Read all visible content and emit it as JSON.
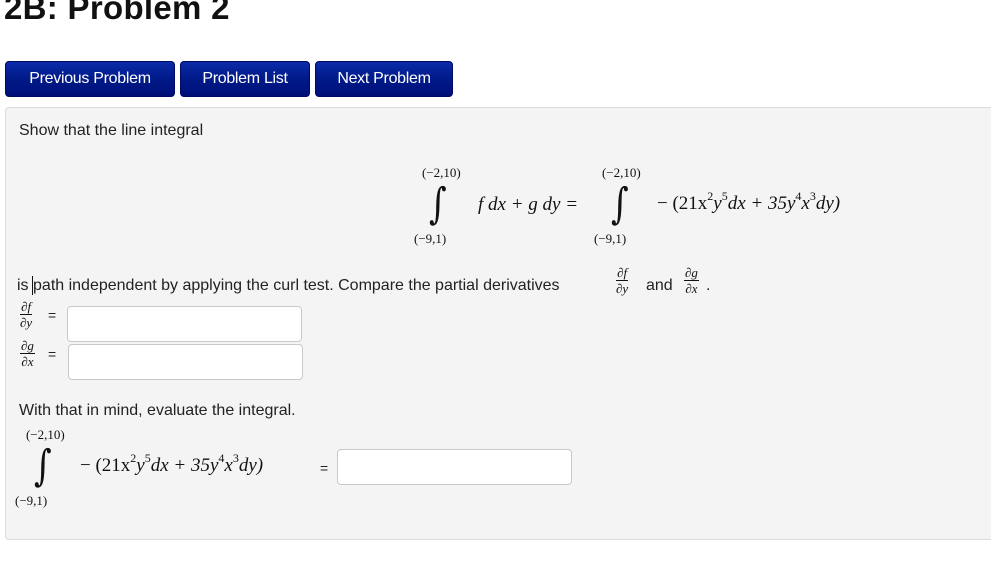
{
  "page": {
    "title": "2B: Problem 2"
  },
  "nav": {
    "previous_label": "Previous Problem",
    "list_label": "Problem List",
    "next_label": "Next Problem"
  },
  "colors": {
    "button_bg": "#001a88",
    "panel_bg": "#f4f4f4"
  },
  "problem": {
    "intro": "Show that the line integral",
    "integral1": {
      "lower": "(−9,1)",
      "upper": "(−2,10)",
      "integrand": "f dx + g dy ="
    },
    "integral2": {
      "lower": "(−9,1)",
      "upper": "(−2,10)",
      "integrand_prefix": "− (21x",
      "exp1": "2",
      "part2": "y",
      "exp2": "5",
      "part3": "dx + 35y",
      "exp3": "4",
      "part4": "x",
      "exp4": "3",
      "part5": "dy)"
    },
    "sentence_start": "is",
    "sentence_rest": "path independent by applying the curl test. Compare the partial derivatives",
    "and_label": "and",
    "period": ".",
    "partials": {
      "df": "∂f",
      "dy": "∂y",
      "dg": "∂g",
      "dx": "∂x"
    },
    "equals": "=",
    "df_dy_answer": {
      "value": "",
      "placeholder": ""
    },
    "dg_dx_answer": {
      "value": "",
      "placeholder": ""
    },
    "evaluate_prompt": "With that in mind, evaluate the integral.",
    "integral_answer": {
      "value": "",
      "placeholder": ""
    }
  }
}
